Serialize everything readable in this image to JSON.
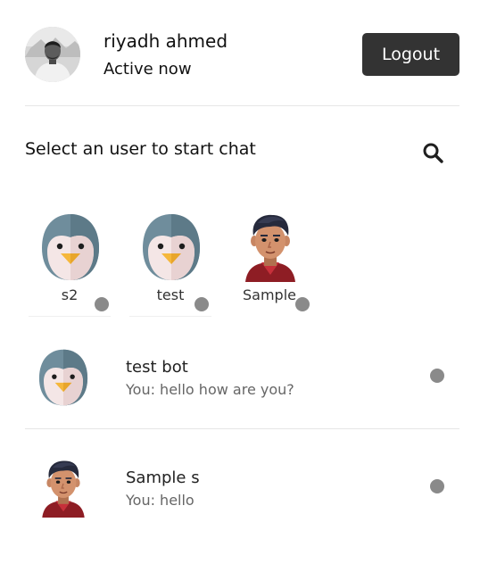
{
  "colors": {
    "logout_bg": "#333333",
    "status_offline": "#8a8a8a",
    "text_primary": "#111111",
    "text_secondary": "#666666"
  },
  "header": {
    "user_name": "riyadh ahmed",
    "status": "Active now",
    "logout_label": "Logout",
    "avatar_icon": "user-photo"
  },
  "search": {
    "title": "Select an user to start chat",
    "icon": "search-icon"
  },
  "active_users": [
    {
      "name": "s2",
      "avatar": "penguin-avatar",
      "status": "offline"
    },
    {
      "name": "test",
      "avatar": "penguin-avatar",
      "status": "offline"
    },
    {
      "name": "Sample",
      "avatar": "man-avatar",
      "status": "offline"
    }
  ],
  "chats": [
    {
      "name": "test bot",
      "message": "You: hello how are you?",
      "avatar": "penguin-avatar",
      "status": "offline"
    },
    {
      "name": "Sample s",
      "message": "You: hello",
      "avatar": "man-avatar",
      "status": "offline"
    }
  ]
}
